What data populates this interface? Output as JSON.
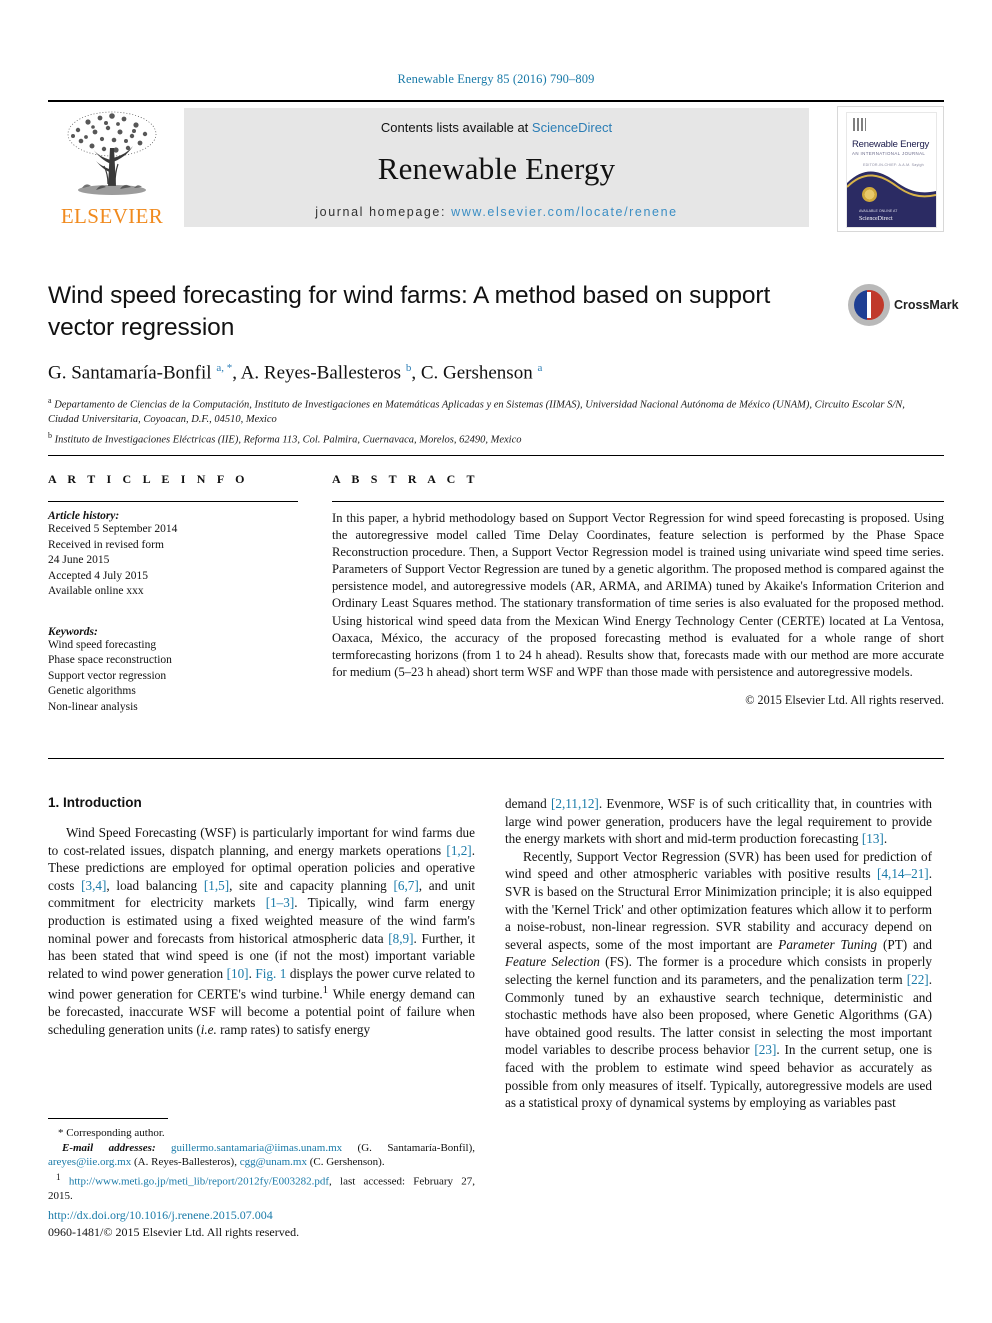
{
  "running_head": "Renewable Energy 85 (2016) 790–809",
  "banner": {
    "publisher": "ELSEVIER",
    "contents_prefix": "Contents lists available at ",
    "contents_link": "ScienceDirect",
    "journal_title": "Renewable Energy",
    "homepage_prefix": "journal homepage: ",
    "homepage_url": "www.elsevier.com/locate/renene",
    "cover": {
      "title": "Renewable Energy",
      "subtitle": "AN INTERNATIONAL JOURNAL",
      "subtitle2": "EDITOR-IN-CHIEF: A.A.M. Sayigh",
      "footer_small": "AVAILABLE ONLINE AT",
      "footer_brand": "ScienceDirect"
    }
  },
  "article": {
    "title": "Wind speed forecasting for wind farms: A method based on support vector regression",
    "crossmark_label": "CrossMark",
    "authors_html": "G. Santamaría-Bonfil <sup class=\"star\">a, *</sup>, A. Reyes-Ballesteros <sup>b</sup>, C. Gershenson <sup>a</sup>",
    "affiliation_a": "Departamento de Ciencias de la Computación, Instituto de Investigaciones en Matemáticas Aplicadas y en Sistemas (IIMAS), Universidad Nacional Autónoma de México (UNAM), Circuito Escolar S/N, Ciudad Universitaria, Coyoacan, D.F., 04510, Mexico",
    "affiliation_b": "Instituto de Investigaciones Eléctricas (IIE), Reforma 113, Col. Palmira, Cuernavaca, Morelos, 62490, Mexico"
  },
  "article_info": {
    "heading": "A R T I C L E  I N F O",
    "history_label": "Article history:",
    "history_lines": [
      "Received 5 September 2014",
      "Received in revised form",
      "24 June 2015",
      "Accepted 4 July 2015",
      "Available online xxx"
    ],
    "keywords_label": "Keywords:",
    "keywords": [
      "Wind speed forecasting",
      "Phase space reconstruction",
      "Support vector regression",
      "Genetic algorithms",
      "Non-linear analysis"
    ]
  },
  "abstract": {
    "heading": "A B S T R A C T",
    "text": "In this paper, a hybrid methodology based on Support Vector Regression for wind speed forecasting is proposed. Using the autoregressive model called Time Delay Coordinates, feature selection is performed by the Phase Space Reconstruction procedure. Then, a Support Vector Regression model is trained using univariate wind speed time series. Parameters of Support Vector Regression are tuned by a genetic algorithm. The proposed method is compared against the persistence model, and autoregressive models (AR, ARMA, and ARIMA) tuned by Akaike's Information Criterion and Ordinary Least Squares method. The stationary transformation of time series is also evaluated for the proposed method. Using historical wind speed data from the Mexican Wind Energy Technology Center (CERTE) located at La Ventosa, Oaxaca, México, the accuracy of the proposed forecasting method is evaluated for a whole range of short termforecasting horizons (from 1 to 24 h ahead). Results show that, forecasts made with our method are more accurate for medium (5–23 h ahead) short term WSF and WPF than those made with persistence and autoregressive models.",
    "copyright": "© 2015 Elsevier Ltd. All rights reserved."
  },
  "body": {
    "section_heading": "1. Introduction",
    "left_paragraph_html": "Wind Speed Forecasting (WSF) is particularly important for wind farms due to cost-related issues, dispatch planning, and energy markets operations <span class=\"ref\">[1,2]</span>. These predictions are employed for optimal operation policies and operative costs <span class=\"ref\">[3,4]</span>, load balancing <span class=\"ref\">[1,5]</span>, site and capacity planning <span class=\"ref\">[6,7]</span>, and unit commitment for electricity markets <span class=\"ref\">[1–3]</span>. Tipically, wind farm energy production is estimated using a fixed weighted measure of the wind farm's nominal power and forecasts from historical atmospheric data <span class=\"ref\">[8,9]</span>. Further, it has been stated that wind speed is one (if not the most) important variable related to wind power generation <span class=\"ref\">[10]</span>. <span class=\"ref\">Fig. 1</span> displays the power curve related to wind power generation for CERTE's wind turbine.<sup>1</sup> While energy demand can be forecasted, inaccurate WSF will become a potential point of failure when scheduling generation units (<i>i.e.</i> ramp rates) to satisfy energy",
    "right_paragraph1_html": "demand <span class=\"ref\">[2,11,12]</span>. Evenmore, WSF is of such criticallity that, in countries with large wind power generation, producers have the legal requirement to provide the energy markets with short and mid-term production forecasting <span class=\"ref\">[13]</span>.",
    "right_paragraph2_html": "Recently, Support Vector Regression (SVR) has been used for prediction of wind speed and other atmospheric variables with positive results <span class=\"ref\">[4,14–21]</span>. SVR is based on the Structural Error Minimization principle; it is also equipped with the 'Kernel Trick' and other optimization features which allow it to perform a noise-robust, non-linear regression. SVR stability and accuracy depend on several aspects, some of the most important are <i>Parameter Tuning</i> (PT) and <i>Feature Selection</i> (FS). The former is a procedure which consists in properly selecting the kernel function and its parameters, and the penalization term <span class=\"ref\">[22]</span>. Commonly tuned by an exhaustive search technique, deterministic and stochastic methods have also been proposed, where Genetic Algorithms (GA) have obtained good results. The latter consist in selecting the most important model variables to describe process behavior <span class=\"ref\">[23]</span>. In the current setup, one is faced with the problem to estimate wind speed behavior as accurately as possible from only measures of itself. Typically, autoregressive models are used as a statistical proxy of dynamical systems by employing as variables past"
  },
  "footnotes": {
    "corresponding_html": "* Corresponding author.",
    "emails_html": "<span class=\"ital\">E-mail addresses:</span> <span class=\"lnk\">guillermo.santamaria@iimas.unam.mx</span> (G. Santamaría-Bonfil), <span class=\"lnk\">areyes@iie.org.mx</span> (A. Reyes-Ballesteros), <span class=\"lnk\">cgg@unam.mx</span> (C. Gershenson).",
    "footnote1_html": "<sup>1</sup> <span class=\"lnk\">http://www.meti.go.jp/meti_lib/report/2012fy/E003282.pdf</span>, last accessed: February 27, 2015."
  },
  "footer": {
    "doi": "http://dx.doi.org/10.1016/j.renene.2015.07.004",
    "issn": "0960-1481/© 2015 Elsevier Ltd. All rights reserved."
  }
}
